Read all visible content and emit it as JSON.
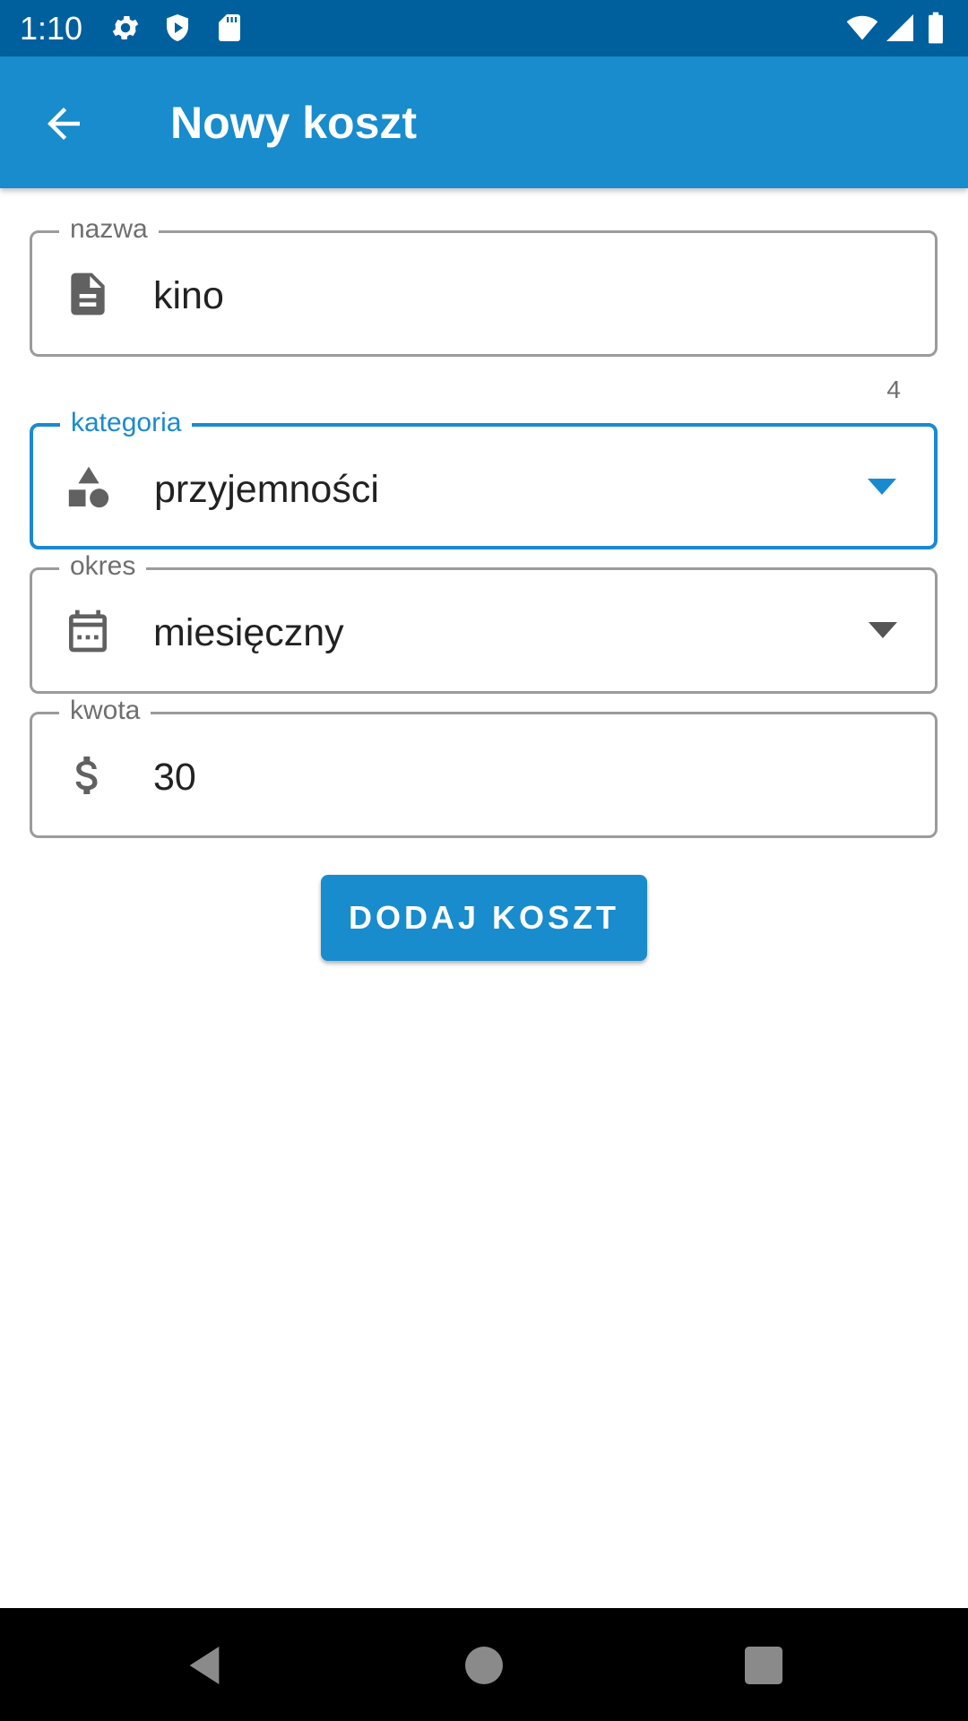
{
  "status_bar": {
    "time": "1:10",
    "left_icons": [
      "gear-icon",
      "shield-icon",
      "sd-card-icon"
    ],
    "right_icons": [
      "wifi-icon",
      "signal-icon",
      "battery-icon"
    ]
  },
  "app_bar": {
    "title": "Nowy koszt",
    "back_icon": "arrow-left-icon"
  },
  "form": {
    "name": {
      "label": "nazwa",
      "value": "kino",
      "icon": "document-icon",
      "counter": "4"
    },
    "category": {
      "label": "kategoria",
      "value": "przyjemności",
      "icon": "shapes-icon",
      "focused": true
    },
    "period": {
      "label": "okres",
      "value": "miesięczny",
      "icon": "calendar-icon"
    },
    "amount": {
      "label": "kwota",
      "value": "30",
      "icon": "dollar-icon"
    },
    "submit_label": "DODAJ KOSZT"
  },
  "colors": {
    "primary": "#188ccc",
    "status_bar": "#00609e",
    "focus": "#1a8ad0",
    "border": "#9b9b9b",
    "nav_bar": "#000000"
  },
  "nav_bar": {
    "icons": [
      "back-triangle-icon",
      "home-circle-icon",
      "recents-square-icon"
    ]
  }
}
